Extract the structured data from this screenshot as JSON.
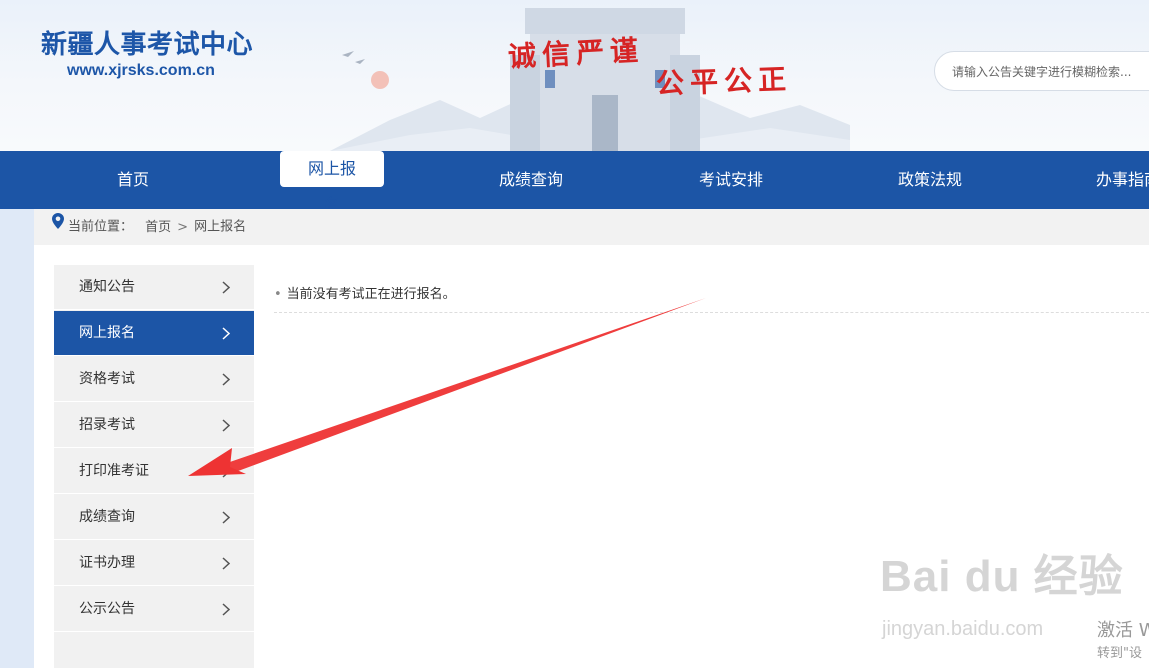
{
  "header": {
    "site_title": "新疆人事考试中心",
    "site_url": "www.xjrsks.com.cn",
    "slogan_line1": "诚信严谨",
    "slogan_line2": "公平公正",
    "search_placeholder": "请输入公告关键字进行模糊检索..."
  },
  "nav": {
    "items": [
      {
        "label": "首页"
      },
      {
        "label": "网上报名",
        "active": true
      },
      {
        "label": "成绩查询"
      },
      {
        "label": "考试安排"
      },
      {
        "label": "政策法规"
      },
      {
        "label": "办事指南"
      }
    ]
  },
  "breadcrumb": {
    "prefix": "当前位置：",
    "home": "首页",
    "separator": ">",
    "current": "网上报名"
  },
  "sidebar": {
    "items": [
      {
        "label": "通知公告"
      },
      {
        "label": "网上报名",
        "active": true
      },
      {
        "label": "资格考试"
      },
      {
        "label": "招录考试"
      },
      {
        "label": "打印准考证"
      },
      {
        "label": "成绩查询"
      },
      {
        "label": "证书办理"
      },
      {
        "label": "公示公告"
      }
    ]
  },
  "content": {
    "notice": "当前没有考试正在进行报名。"
  },
  "watermark": {
    "brand": "Bai du 经验",
    "url": "jingyan.baidu.com"
  },
  "os_overlay": {
    "line1": "激活 W",
    "line2": "转到\"设"
  },
  "colors": {
    "brand_blue": "#1c55a6",
    "slogan_red": "#d62424",
    "annotation_red": "#ee3333"
  }
}
